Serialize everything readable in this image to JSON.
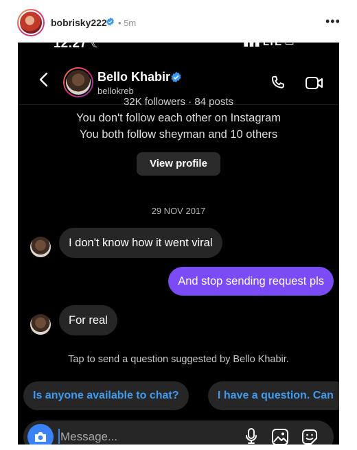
{
  "post": {
    "username": "bobrisky222",
    "separator": "•",
    "time": "5m",
    "more": "•••"
  },
  "screenshot": {
    "status": {
      "time": "12:27 ☾",
      "right": "▮▮▮ LTE ▭"
    },
    "chat": {
      "name": "Bello Khabir",
      "handle": "bellokreb",
      "cut_text": "32K followers · 84 posts",
      "info_line1": "You don't follow each other on Instagram",
      "info_line2": "You both follow sheyman and 10 others",
      "view_profile": "View profile",
      "date": "29 NOV 2017"
    },
    "messages": [
      {
        "from": "them",
        "text": "I don't know how it went viral"
      },
      {
        "from": "me",
        "text": "And stop sending request pls"
      },
      {
        "from": "them",
        "text": "For real"
      }
    ],
    "suggest_note": "Tap to send a question suggested by Bello Khabir.",
    "suggestions": [
      "Is anyone available to chat?",
      "I have a question. Can"
    ],
    "composer": {
      "placeholder": "Message..."
    }
  },
  "colors": {
    "accent": "#7b4cf5",
    "link": "#3f9bf0",
    "verified": "#3897f0"
  }
}
